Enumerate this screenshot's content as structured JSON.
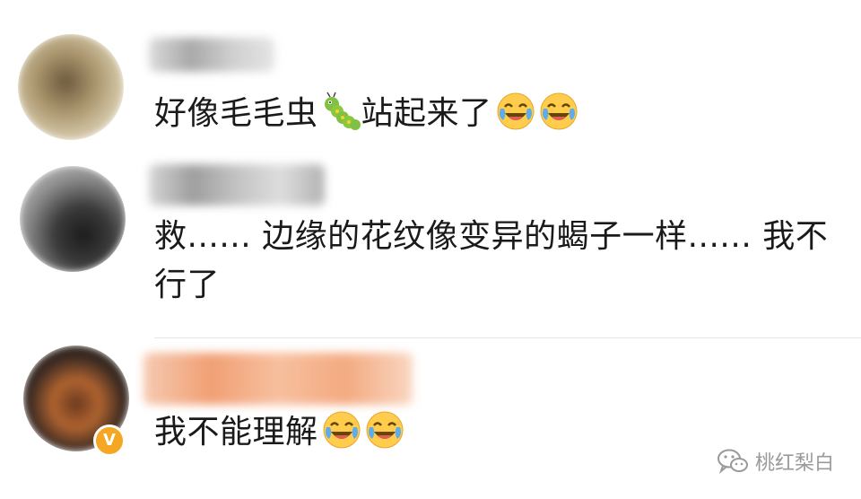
{
  "comments": [
    {
      "text_before": "好像毛毛虫",
      "text_after": "站起来了",
      "icons": [
        "caterpillar-icon",
        "laugh-cry-icon",
        "laugh-cry-icon"
      ]
    },
    {
      "text_line1": "救...... 边缘的花纹像变异的蝎子一样...... 我不",
      "text_line2": "行了"
    },
    {
      "text": "我不能理解",
      "icons": [
        "laugh-cry-icon",
        "laugh-cry-icon"
      ],
      "verified_badge": "V"
    }
  ],
  "watermark": {
    "label": "桃红梨白",
    "icon": "wechat-icon"
  },
  "colors": {
    "verified": "#f5a623",
    "text": "#1a1a1a",
    "watermark": "#9a9a9a"
  }
}
